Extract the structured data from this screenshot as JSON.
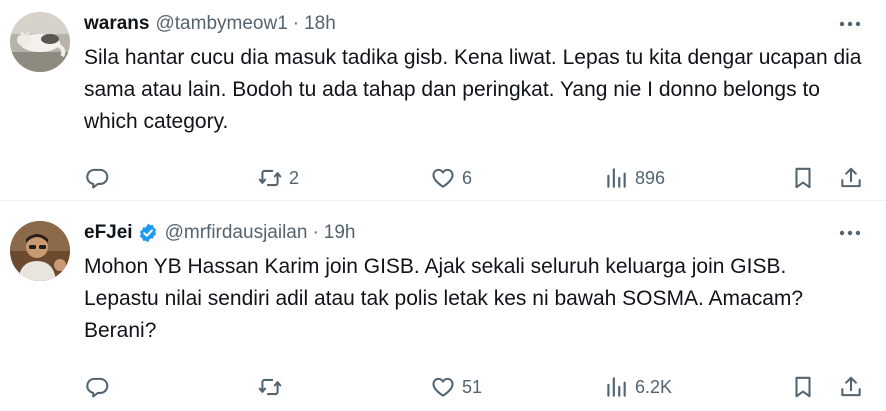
{
  "tweets": [
    {
      "name": "warans",
      "handle": "@tambymeow1",
      "separator": "·",
      "time": "18h",
      "verified": false,
      "text": "Sila hantar cucu dia masuk tadika gisb. Kena liwat. Lepas tu kita dengar ucapan dia sama atau lain. Bodoh tu ada tahap dan peringkat. Yang nie I donno belongs to which category.",
      "replies": "",
      "retweets": "2",
      "likes": "6",
      "views": "896"
    },
    {
      "name": "eFJei",
      "handle": "@mrfirdausjailan",
      "separator": "·",
      "time": "19h",
      "verified": true,
      "text": "Mohon YB Hassan Karim join GISB. Ajak sekali seluruh keluarga join GISB. Lepastu nilai sendiri adil atau tak polis letak kes ni bawah SOSMA. Amacam? Berani?",
      "replies": "",
      "retweets": "",
      "likes": "51",
      "views": "6.2K"
    }
  ],
  "icons": {
    "more": "more-dots-icon",
    "reply": "reply-bubble-icon",
    "retweet": "retweet-icon",
    "like": "heart-icon",
    "views": "views-bar-chart-icon",
    "bookmark": "bookmark-icon",
    "share": "share-upload-icon",
    "verified": "verified-badge-icon"
  },
  "colors": {
    "text": "#0f1419",
    "muted": "#536471",
    "verified": "#1d9bf0",
    "divider": "#eff3f4"
  }
}
